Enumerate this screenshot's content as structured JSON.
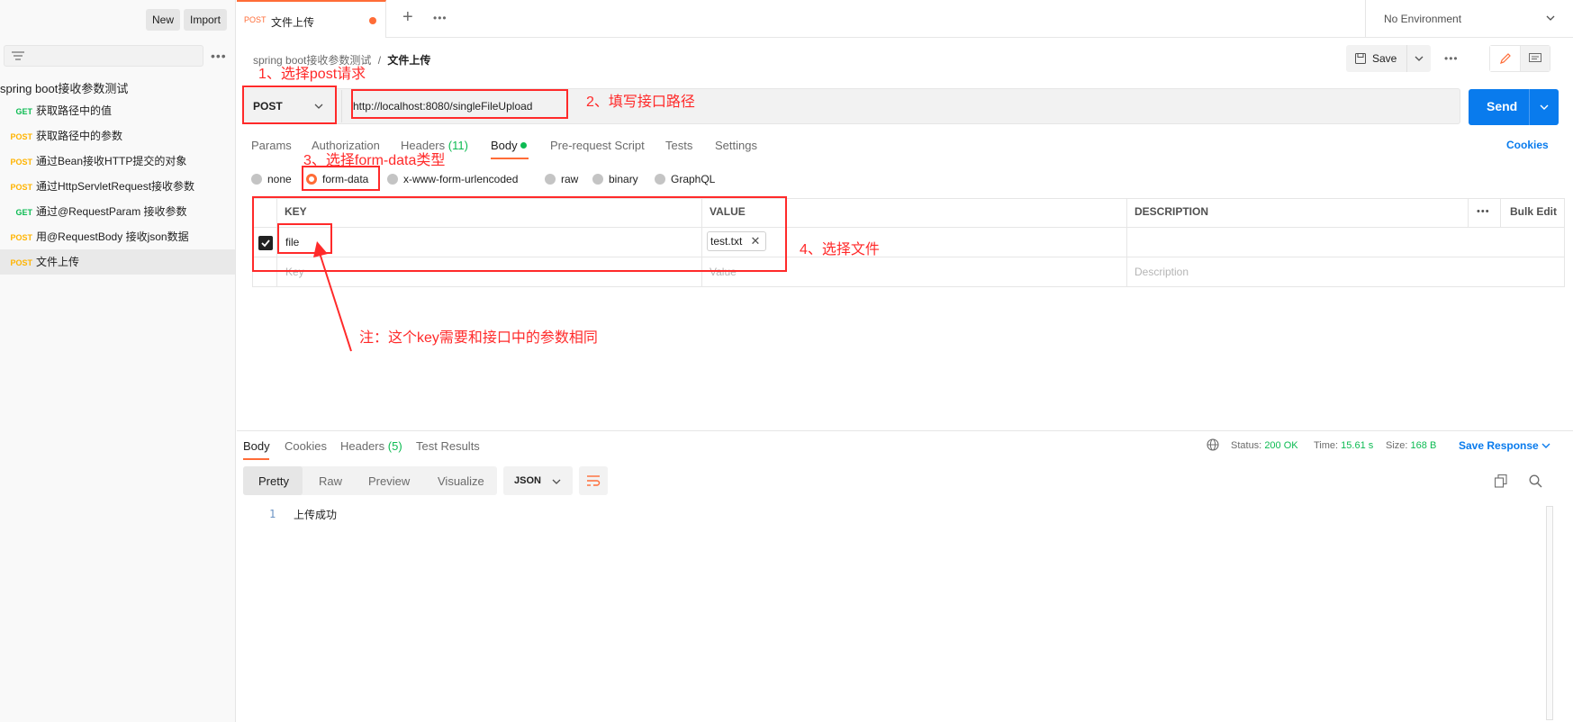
{
  "sidebar": {
    "new_label": "New",
    "import_label": "Import",
    "collection_name": "spring boot接收参数测试",
    "items": [
      {
        "method": "GET",
        "name": "获取路径中的值"
      },
      {
        "method": "POST",
        "name": "获取路径中的参数"
      },
      {
        "method": "POST",
        "name": "通过Bean接收HTTP提交的对象"
      },
      {
        "method": "POST",
        "name": "通过HttpServletRequest接收参数"
      },
      {
        "method": "GET",
        "name": "通过@RequestParam 接收参数"
      },
      {
        "method": "POST",
        "name": "用@RequestBody 接收json数据"
      },
      {
        "method": "POST",
        "name": "文件上传"
      }
    ]
  },
  "tabbar": {
    "tab_method": "POST",
    "tab_title": "文件上传",
    "add_label": "+",
    "environment": "No Environment"
  },
  "header": {
    "breadcrumb_collection": "spring boot接收参数测试",
    "breadcrumb_sep": "/",
    "breadcrumb_request": "文件上传",
    "save_label": "Save"
  },
  "request": {
    "method": "POST",
    "url": "http://localhost:8080/singleFileUpload",
    "send_label": "Send"
  },
  "subtabs": {
    "params": "Params",
    "authorization": "Authorization",
    "headers": "Headers",
    "headers_count": "(11)",
    "body": "Body",
    "prerequest": "Pre-request Script",
    "tests": "Tests",
    "settings": "Settings",
    "cookies": "Cookies"
  },
  "body_types": {
    "none": "none",
    "form_data": "form-data",
    "urlencoded": "x-www-form-urlencoded",
    "raw": "raw",
    "binary": "binary",
    "graphql": "GraphQL"
  },
  "table": {
    "col_key": "KEY",
    "col_value": "VALUE",
    "col_description": "DESCRIPTION",
    "bulk_edit": "Bulk Edit",
    "row_key": "file",
    "row_file": "test.txt",
    "placeholder_key": "Key",
    "placeholder_value": "Value",
    "placeholder_description": "Description"
  },
  "annotations": {
    "step1": "1、选择post请求",
    "step2": "2、填写接口路径",
    "step3": "3、选择form-data类型",
    "step4": "4、选择文件",
    "note": "注：这个key需要和接口中的参数相同"
  },
  "response": {
    "tab_body": "Body",
    "tab_cookies": "Cookies",
    "tab_headers": "Headers",
    "headers_count": "(5)",
    "tab_tests": "Test Results",
    "status_label": "Status:",
    "status_value": "200 OK",
    "time_label": "Time:",
    "time_value": "15.61 s",
    "size_label": "Size:",
    "size_value": "168 B",
    "save_response": "Save Response",
    "view_pretty": "Pretty",
    "view_raw": "Raw",
    "view_preview": "Preview",
    "view_visualize": "Visualize",
    "format": "JSON",
    "line_number": "1",
    "body_text": "上传成功"
  },
  "colors": {
    "accent": "#ff6c37",
    "send_blue": "#097bed",
    "annotation_red": "#ff2a2a",
    "get_green": "#0cbb52",
    "post_orange": "#ffb400"
  }
}
